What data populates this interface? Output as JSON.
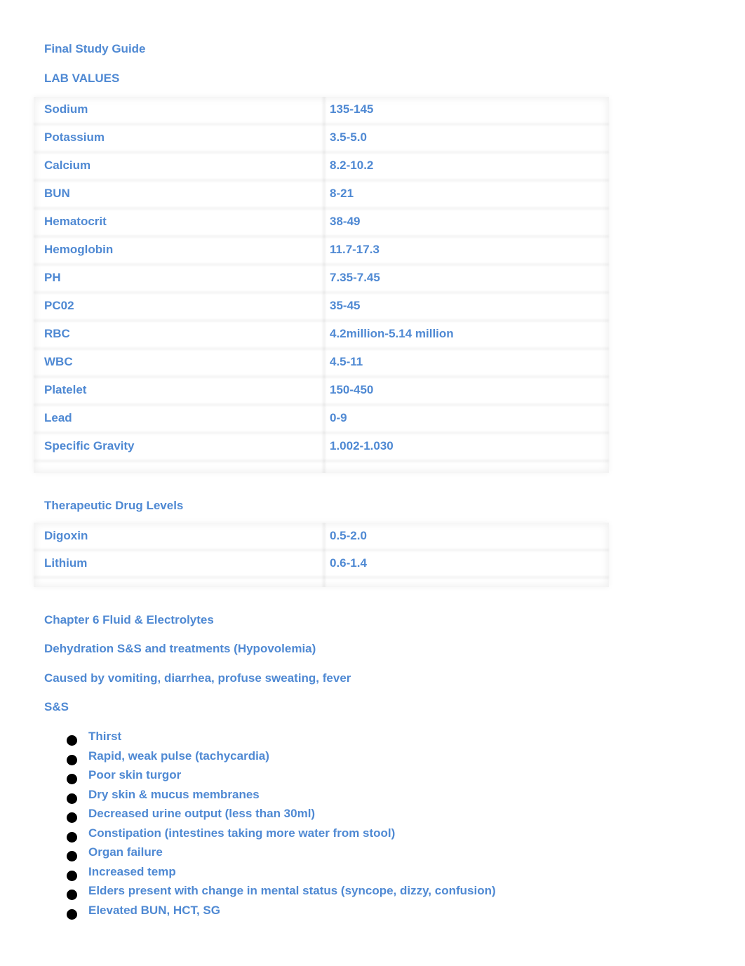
{
  "document": {
    "title": "Final Study Guide",
    "lab_values_heading": "LAB VALUES",
    "lab_values": [
      {
        "name": "Sodium",
        "range": "135-145"
      },
      {
        "name": "Potassium",
        "range": "3.5-5.0"
      },
      {
        "name": "Calcium",
        "range": "8.2-10.2"
      },
      {
        "name": "BUN",
        "range": "8-21"
      },
      {
        "name": "Hematocrit",
        "range": "38-49"
      },
      {
        "name": "Hemoglobin",
        "range": "11.7-17.3"
      },
      {
        "name": "PH",
        "range": "7.35-7.45"
      },
      {
        "name": "PC02",
        "range": "35-45"
      },
      {
        "name": "RBC",
        "range": "4.2million-5.14 million"
      },
      {
        "name": "WBC",
        "range": "4.5-11"
      },
      {
        "name": "Platelet",
        "range": "150-450"
      },
      {
        "name": "Lead",
        "range": "0-9"
      },
      {
        "name": "Specific Gravity",
        "range": "1.002-1.030"
      }
    ],
    "drug_levels_heading": "Therapeutic Drug Levels",
    "drug_levels": [
      {
        "name": "Digoxin",
        "range": "0.5-2.0"
      },
      {
        "name": "Lithium",
        "range": "0.6-1.4"
      }
    ],
    "chapter_heading": "Chapter 6 Fluid & Electrolytes",
    "dehydration_heading": "Dehydration S&S and treatments (Hypovolemia)",
    "causes": "Caused by vomiting, diarrhea, profuse sweating, fever",
    "ss_heading": "S&S",
    "symptoms": [
      "Thirst",
      "Rapid, weak pulse (tachycardia)",
      "Poor skin turgor",
      "Dry skin & mucus membranes",
      "Decreased urine output (less than 30ml)",
      "Constipation (intestines taking more water from stool)",
      "Organ failure",
      "Increased temp",
      "Elders present with change in mental status (syncope, dizzy, confusion)",
      "Elevated BUN, HCT, SG"
    ]
  },
  "colors": {
    "text": "#4f89d3",
    "bullet": "#000000"
  }
}
